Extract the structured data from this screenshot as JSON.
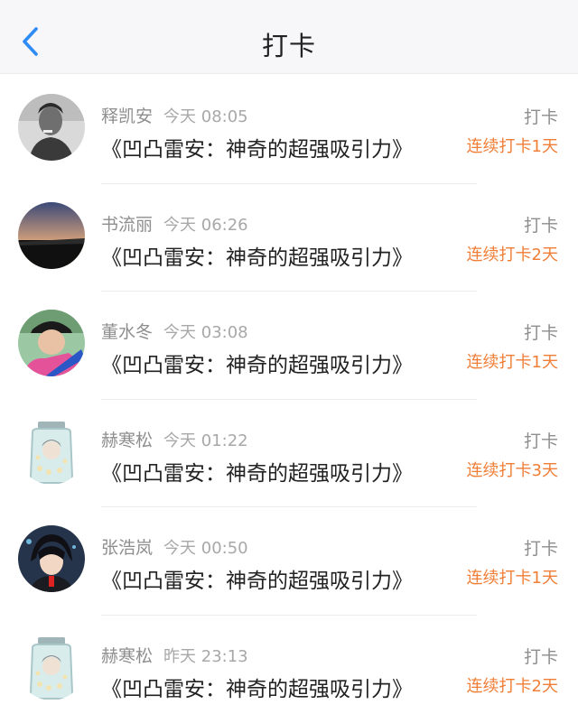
{
  "header": {
    "title": "打卡",
    "back_icon": "chevron-left-icon"
  },
  "colors": {
    "accent_blue": "#2f8bf5",
    "streak_orange": "#f07e37"
  },
  "entries": [
    {
      "name": "释凯安",
      "time": "今天 08:05",
      "content": "《凹凸雷安：神奇的超强吸引力》",
      "action": "打卡",
      "streak": "连续打卡1天",
      "avatar": "bw-portrait-avatar"
    },
    {
      "name": "书流丽",
      "time": "今天 06:26",
      "content": "《凹凸雷安：神奇的超强吸引力》",
      "action": "打卡",
      "streak": "连续打卡2天",
      "avatar": "sunset-landscape-avatar"
    },
    {
      "name": "董水冬",
      "time": "今天 03:08",
      "content": "《凹凸雷安：神奇的超强吸引力》",
      "action": "打卡",
      "streak": "连续打卡1天",
      "avatar": "person-cap-avatar"
    },
    {
      "name": "赫寒松",
      "time": "今天 01:22",
      "content": "《凹凸雷安：神奇的超强吸引力》",
      "action": "打卡",
      "streak": "连续打卡3天",
      "avatar": "jar-character-avatar"
    },
    {
      "name": "张浩岚",
      "time": "今天 00:50",
      "content": "《凹凸雷安：神奇的超强吸引力》",
      "action": "打卡",
      "streak": "连续打卡1天",
      "avatar": "anime-character-avatar"
    },
    {
      "name": "赫寒松",
      "time": "昨天 23:13",
      "content": "《凹凸雷安：神奇的超强吸引力》",
      "action": "打卡",
      "streak": "连续打卡2天",
      "avatar": "jar-character-avatar"
    }
  ]
}
